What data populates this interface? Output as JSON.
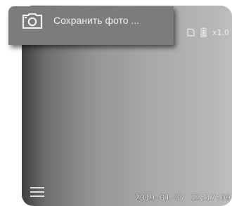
{
  "toast": {
    "label": "Сохранить фото ...",
    "icon": "camera-icon"
  },
  "status": {
    "storage_icon": "sd-card-icon",
    "battery_icon": "battery-icon",
    "zoom": "x1.0"
  },
  "footer": {
    "menu_icon": "hamburger-menu-icon",
    "date": "2019-01-07",
    "time": "12:17:09"
  },
  "colors": {
    "toast_bg": "#7c7c7c",
    "text": "#ececec"
  }
}
